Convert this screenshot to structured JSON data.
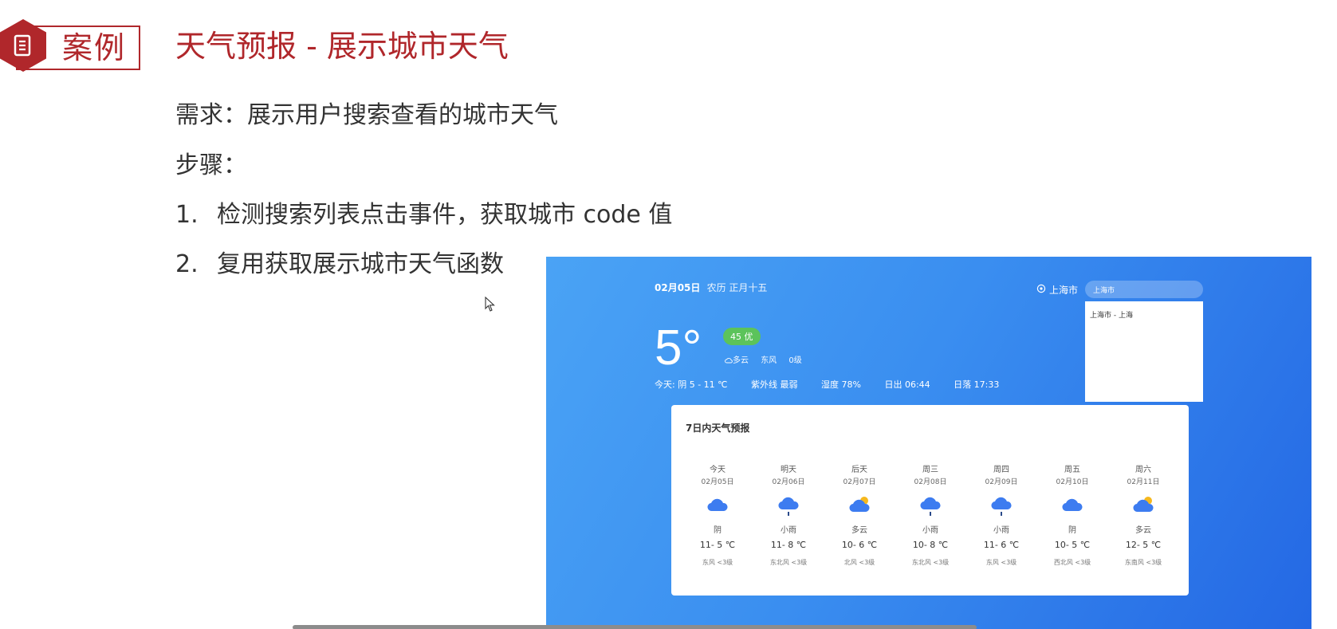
{
  "header": {
    "badge_label": "案例",
    "title": "天气预报 - 展示城市天气"
  },
  "content": {
    "requirement": "需求：展示用户搜索查看的城市天气",
    "steps_label": "步骤：",
    "steps": [
      {
        "num": "1.",
        "text": "检测搜索列表点击事件，获取城市 code 值"
      },
      {
        "num": "2.",
        "text": "复用获取展示城市天气函数"
      }
    ]
  },
  "weather_app": {
    "date": "02月05日",
    "lunar": "农历  正月十五",
    "location": "上海市",
    "search_value": "上海市",
    "dropdown_items": [
      "上海市 - 上海"
    ],
    "temperature": "5°",
    "aqi": "45 优",
    "condition": {
      "weather": "多云",
      "wind_dir": "东风",
      "wind_level": "0级"
    },
    "today": {
      "range": "今天:  阴 5 - 11 ℃",
      "uv": "紫外线 最弱",
      "humidity": "湿度 78%",
      "sunrise": "日出 06:44",
      "sunset": "日落 17:33"
    },
    "forecast_title": "7日内天气预报",
    "days": [
      {
        "name": "今天",
        "date": "02月05日",
        "weather": "阴",
        "temp": "11- 5 ℃",
        "wind": "东风 <3级",
        "icon": "cloudy"
      },
      {
        "name": "明天",
        "date": "02月06日",
        "weather": "小雨",
        "temp": "11- 8 ℃",
        "wind": "东北风 <3级",
        "icon": "rain"
      },
      {
        "name": "后天",
        "date": "02月07日",
        "weather": "多云",
        "temp": "10- 6 ℃",
        "wind": "北风 <3级",
        "icon": "partly-cloudy"
      },
      {
        "name": "周三",
        "date": "02月08日",
        "weather": "小雨",
        "temp": "10- 8 ℃",
        "wind": "东北风 <3级",
        "icon": "rain"
      },
      {
        "name": "周四",
        "date": "02月09日",
        "weather": "小雨",
        "temp": "11- 6 ℃",
        "wind": "东风 <3级",
        "icon": "rain"
      },
      {
        "name": "周五",
        "date": "02月10日",
        "weather": "阴",
        "temp": "10- 5 ℃",
        "wind": "西北风 <3级",
        "icon": "cloudy"
      },
      {
        "name": "周六",
        "date": "02月11日",
        "weather": "多云",
        "temp": "12- 5 ℃",
        "wind": "东南风 <3级",
        "icon": "partly-cloudy"
      }
    ]
  }
}
